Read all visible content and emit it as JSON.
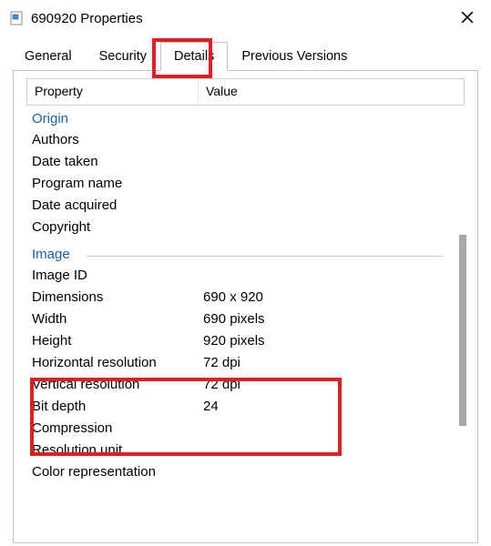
{
  "titlebar": {
    "title": "690920 Properties"
  },
  "tabs": {
    "general": "General",
    "security": "Security",
    "details": "Details",
    "previous": "Previous Versions",
    "active": "details"
  },
  "headers": {
    "property": "Property",
    "value": "Value"
  },
  "sections": {
    "origin": "Origin",
    "image": "Image"
  },
  "props": {
    "authors": {
      "label": "Authors",
      "value": ""
    },
    "date_taken": {
      "label": "Date taken",
      "value": ""
    },
    "program_name": {
      "label": "Program name",
      "value": ""
    },
    "date_acquired": {
      "label": "Date acquired",
      "value": ""
    },
    "copyright": {
      "label": "Copyright",
      "value": ""
    },
    "image_id": {
      "label": "Image ID",
      "value": ""
    },
    "dimensions": {
      "label": "Dimensions",
      "value": "690 x 920"
    },
    "width": {
      "label": "Width",
      "value": "690 pixels"
    },
    "height": {
      "label": "Height",
      "value": "920 pixels"
    },
    "hres": {
      "label": "Horizontal resolution",
      "value": "72 dpi"
    },
    "vres": {
      "label": "Vertical resolution",
      "value": "72 dpi"
    },
    "bitdepth": {
      "label": "Bit depth",
      "value": "24"
    },
    "compression": {
      "label": "Compression",
      "value": ""
    },
    "resunit": {
      "label": "Resolution unit",
      "value": ""
    },
    "colorrep": {
      "label": "Color representation",
      "value": ""
    }
  }
}
